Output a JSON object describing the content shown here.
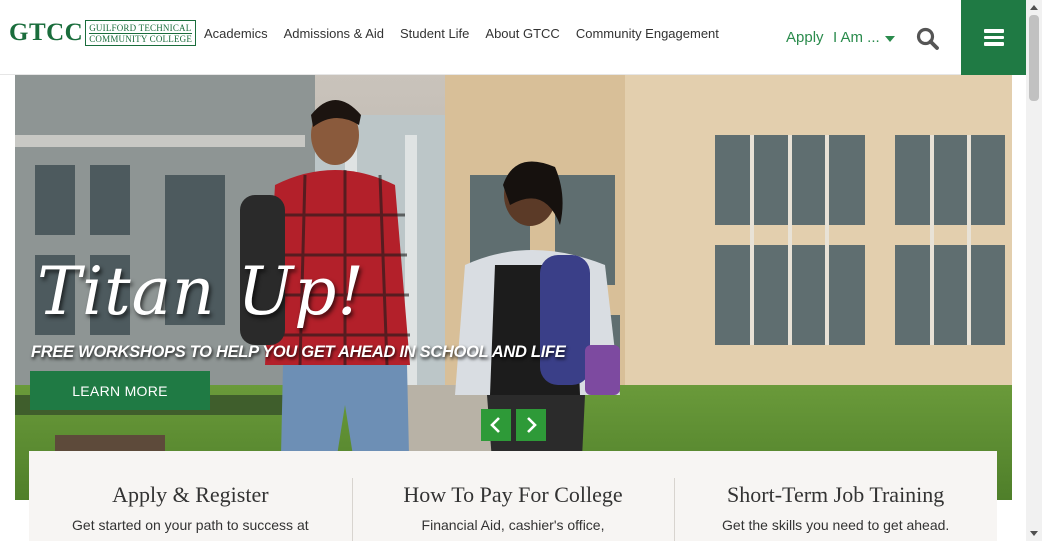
{
  "logo": {
    "mark": "GTCC",
    "line1": "GUILFORD TECHNICAL",
    "line2": "COMMUNITY COLLEGE"
  },
  "nav": {
    "items": [
      "Academics",
      "Admissions & Aid",
      "Student Life",
      "About GTCC",
      "Community Engagement"
    ]
  },
  "utility": {
    "apply_label": "Apply",
    "iam_label": "I Am ..."
  },
  "icons": {
    "search": "search-icon",
    "menu": "hamburger-menu-icon",
    "prev": "chevron-left-icon",
    "next": "chevron-right-icon",
    "pause": "pause-icon"
  },
  "hero": {
    "title": "Titan Up!",
    "subtitle": "FREE WORKSHOPS TO HELP YOU GET AHEAD IN SCHOOL AND LIFE",
    "button_label": "LEARN MORE"
  },
  "cards": [
    {
      "title": "Apply & Register",
      "text": "Get started on your path to success at"
    },
    {
      "title": "How To Pay For College",
      "text": "Financial Aid, cashier's office,"
    },
    {
      "title": "Short-Term Job Training",
      "text": "Get the skills you need to get ahead."
    }
  ],
  "colors": {
    "brand_green": "#1f7a44",
    "link_green": "#2a8b4c",
    "arrow_green": "#2e9a38",
    "card_bg": "#f7f5f3"
  }
}
